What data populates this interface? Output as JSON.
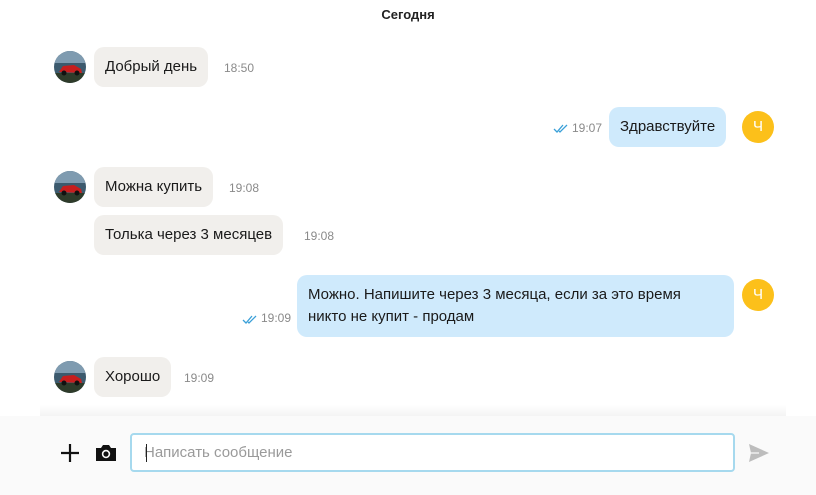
{
  "chat": {
    "date_label": "Сегодня",
    "messages": [
      {
        "direction": "in",
        "text": "Добрый день",
        "time": "18:50",
        "has_avatar": true
      },
      {
        "direction": "out",
        "text": "Здравствуйте",
        "time": "19:07",
        "status": "read",
        "avatar_letter": "Ч"
      },
      {
        "direction": "in",
        "text": "Можна купить",
        "time": "19:08",
        "has_avatar": true
      },
      {
        "direction": "in",
        "text": "Толька через 3 месяцев",
        "time": "19:08",
        "has_avatar": false
      },
      {
        "direction": "out",
        "lines": [
          "Можно. Напишите через 3 месяца, если за это время",
          "никто не купит - продам"
        ],
        "time": "19:09",
        "status": "read",
        "avatar_letter": "Ч"
      },
      {
        "direction": "in",
        "text": "Хорошо",
        "time": "19:09",
        "has_avatar": true
      }
    ]
  },
  "composer": {
    "placeholder": "Написать сообщение",
    "value": "",
    "icons": {
      "attach": "plus-icon",
      "camera": "camera-icon",
      "send": "send-icon"
    }
  },
  "colors": {
    "incoming_bubble": "#f1efec",
    "outgoing_bubble": "#cfeafc",
    "self_avatar": "#fcc01a",
    "input_border": "#a6d9ee",
    "read_check": "#3aa0d8"
  }
}
